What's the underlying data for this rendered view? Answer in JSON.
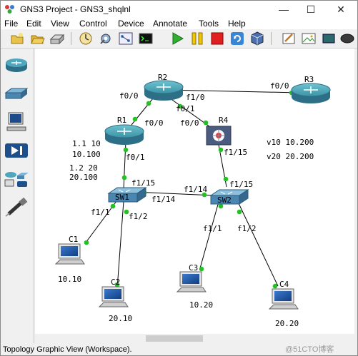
{
  "window": {
    "title": "GNS3 Project - GNS3_shqlnl",
    "controls": {
      "minimize": "—",
      "maximize": "☐",
      "close": "✕"
    }
  },
  "menu": [
    "File",
    "Edit",
    "View",
    "Control",
    "Device",
    "Annotate",
    "Tools",
    "Help"
  ],
  "toolbar": {
    "buttons": [
      "new-project",
      "open-project",
      "save-project",
      "snapshot",
      "preferences",
      "topology-summary",
      "console",
      "start-all",
      "suspend-all",
      "stop-all",
      "reload-all",
      "virtualbox",
      "add-note",
      "insert-image",
      "draw-rectangle",
      "draw-ellipse"
    ]
  },
  "device_dock": [
    "routers",
    "switches",
    "end-devices",
    "security-devices",
    "all-devices",
    "add-link"
  ],
  "topology": {
    "devices": {
      "R1": "R1",
      "R2": "R2",
      "R3": "R3",
      "R4": "R4",
      "SW1": "SW1",
      "SW2": "SW2",
      "C1": "C1",
      "C2": "C2",
      "C3": "C3",
      "C4": "C4"
    },
    "ports": {
      "r2_f00": "f0/0",
      "r2_f10": "f1/0",
      "r2_f01": "f0/1",
      "r3_f00": "f0/0",
      "r1_f00": "f0/0",
      "r1_f01": "f0/1",
      "r4_f00": "f0/0",
      "r4_f115": "f1/15",
      "sw1_f115": "f1/15",
      "sw1_f114": "f1/14",
      "sw1_f11": "f1/1",
      "sw1_f12": "f1/2",
      "sw2_f114": "f1/14",
      "sw2_f115": "f1/15",
      "sw2_f11": "f1/1",
      "sw2_f12": "f1/2"
    },
    "notes": {
      "r1_ip1": "1.1 10",
      "r1_ip2": "10.100",
      "r1_ip3": "1.2 20",
      "r1_ip4": "20.100",
      "vlan10": "v10 10.200",
      "vlan20": "v20 20.200",
      "c1_ip": "10.10",
      "c2_ip": "20.10",
      "c3_ip": "10.20",
      "c4_ip": "20.20"
    }
  },
  "statusbar": {
    "text": "Topology Graphic View (Workspace)."
  },
  "watermark": "@51CTO博客",
  "colors": {
    "router": "#4aa2b0",
    "link": "#000000",
    "port_dot": "#22c222",
    "firewall": "#5a6a8a",
    "switch": "#7fb4d6"
  }
}
